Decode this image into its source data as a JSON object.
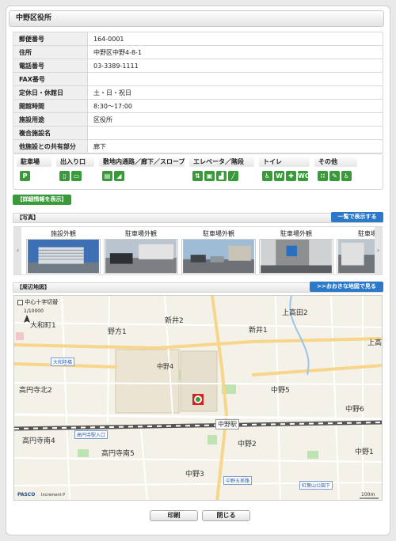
{
  "title": "中野区役所",
  "info_rows": [
    {
      "key": "郵便番号",
      "value": "164-0001"
    },
    {
      "key": "住所",
      "value": "中野区中野4-8-1"
    },
    {
      "key": "電話番号",
      "value": "03-3389-1111"
    },
    {
      "key": "FAX番号",
      "value": ""
    },
    {
      "key": "定休日・休館日",
      "value": "土・日・祝日"
    },
    {
      "key": "開館時間",
      "value": "8:30～17:00"
    },
    {
      "key": "施設用途",
      "value": "区役所"
    },
    {
      "key": "複合施設名",
      "value": ""
    },
    {
      "key": "他施設との共有部分",
      "value": "廊下"
    }
  ],
  "facility": {
    "categories": [
      "駐車場",
      "出入り口",
      "敷地内通路／廊下／スロープ",
      "エレベータ／階段",
      "トイレ",
      "その他"
    ]
  },
  "detail_button": "【詳細情報を表示】",
  "photos": {
    "section_label": "【写真】",
    "list_all_button": "一覧で表示する",
    "prev": "‹",
    "next": "›",
    "captions": [
      "施設外観",
      "駐車場外観",
      "駐車場外観",
      "駐車場外観",
      "駐車場外観"
    ]
  },
  "map": {
    "section_label": "【周辺地図】",
    "big_map_button": ">>おおきな地図で見る",
    "center_cross_label": "中心十字切替",
    "scale_ratio": "1/10000",
    "scale_bar": "100m",
    "brand": "PASCO",
    "brand_small": "Increment P",
    "labels": {
      "nogata1": "大和町1",
      "noda1": "野方1",
      "arai2": "新井2",
      "arai1": "新井1",
      "kamitakada2": "上高田2",
      "kamitakada": "上高",
      "nakano4": "中野4",
      "nakano5": "中野5",
      "nakano6": "中野6",
      "nakano2": "中野2",
      "nakano3": "中野3",
      "nakano1": "中野1",
      "koenji_kita2": "高円寺北2",
      "koenji_minami4": "高円寺南4",
      "koenji_minami5": "高円寺南5",
      "nakano_station": "中野駅",
      "yamato_road": "大和陸橋",
      "koenji_sta_entrance": "高円寺駅入口",
      "nakano_5way": "中野五差路",
      "nakano_5way_sub": "中野五差路",
      "kotobuki": "紅葉山公園下"
    }
  },
  "buttons": {
    "print": "印刷",
    "close": "閉じる"
  },
  "colors": {
    "green": "#3a9a3a",
    "blue": "#2b79c8"
  }
}
